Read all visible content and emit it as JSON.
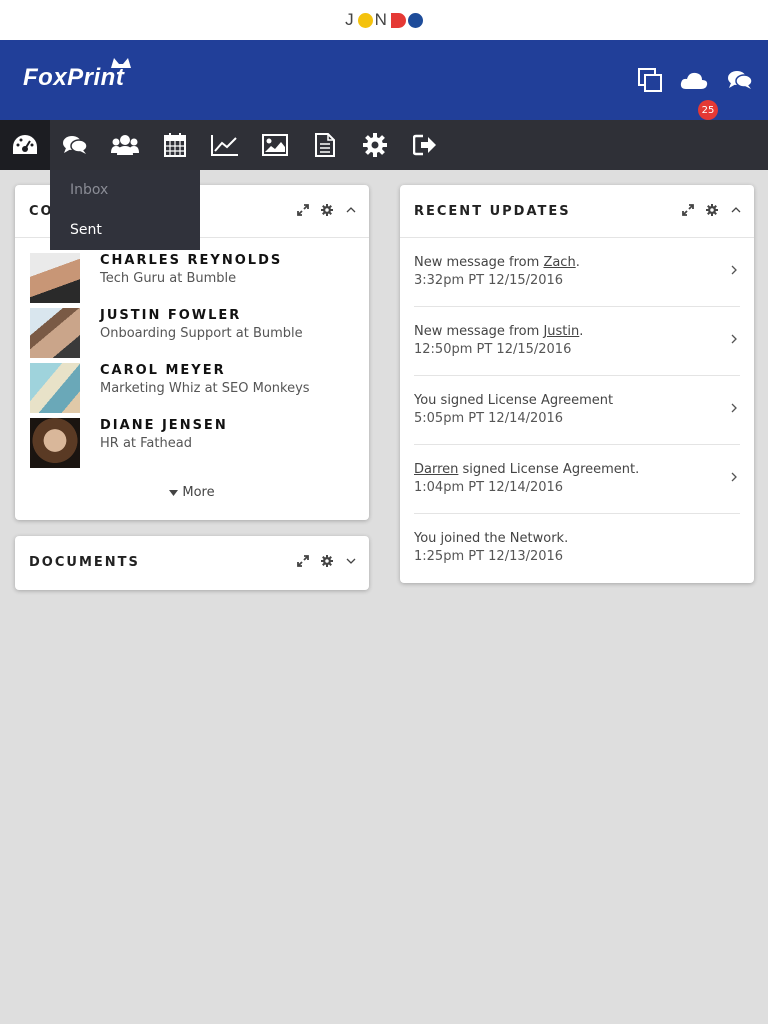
{
  "brand_strip": {
    "letters": [
      "J",
      "O",
      "N",
      "D",
      "O"
    ],
    "colors": {
      "yellow": "#f4c20d",
      "red": "#e53935",
      "blue": "#1e4c9a"
    }
  },
  "header": {
    "logo_text": "FoxPrint",
    "bg": "#213f99",
    "icons": [
      "copy-icon",
      "cloud-icon",
      "chat-icon"
    ],
    "notification_count": "25"
  },
  "nav": {
    "items": [
      "dashboard-icon",
      "messages-icon",
      "users-icon",
      "calendar-icon",
      "analytics-icon",
      "image-icon",
      "document-icon",
      "settings-icon",
      "logout-icon"
    ],
    "active": "dashboard"
  },
  "messages_menu": {
    "items": [
      "Inbox",
      "Sent"
    ]
  },
  "contacts_card": {
    "title": "CONTACTS",
    "contacts": [
      {
        "name": "CHARLES REYNOLDS",
        "role": "Tech Guru at Bumble"
      },
      {
        "name": "JUSTIN FOWLER",
        "role": "Onboarding Support at Bumble"
      },
      {
        "name": "CAROL MEYER",
        "role": "Marketing Whiz at SEO Monkeys"
      },
      {
        "name": "DIANE JENSEN",
        "role": "HR at Fathead"
      }
    ],
    "more_label": "More"
  },
  "documents_card": {
    "title": "DOCUMENTS"
  },
  "updates_card": {
    "title": "RECENT UPDATES",
    "items": [
      {
        "pre": "New message from ",
        "link": "Zach",
        "post": ".",
        "time": "3:32pm PT 12/15/2016"
      },
      {
        "pre": "New message from ",
        "link": "Justin",
        "post": ".",
        "time": "12:50pm PT 12/15/2016"
      },
      {
        "pre": "You signed License Agreement",
        "link": "",
        "post": "",
        "time": "5:05pm PT 12/14/2016"
      },
      {
        "pre": "",
        "link": "Darren",
        "post": " signed License Agreement.",
        "time": "1:04pm PT 12/14/2016"
      },
      {
        "pre": "You joined the Network.",
        "link": "",
        "post": "",
        "time": "1:25pm PT 12/13/2016"
      }
    ]
  }
}
